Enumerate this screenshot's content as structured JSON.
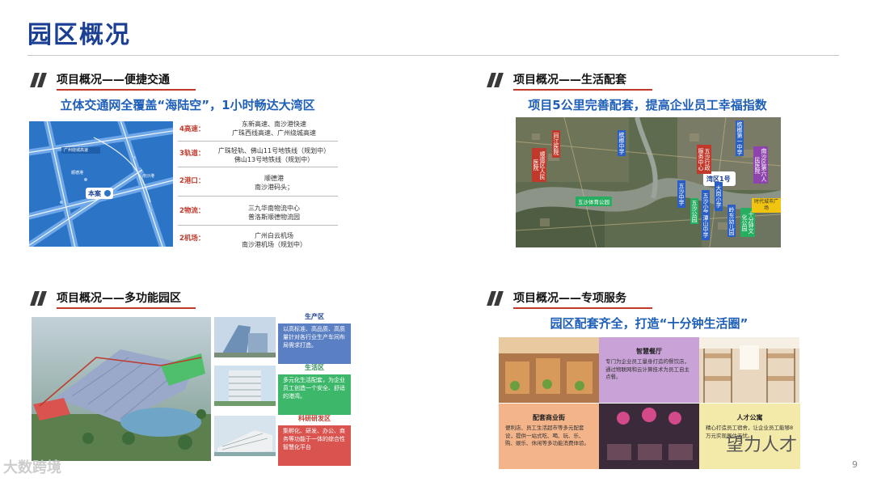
{
  "page": {
    "title": "园区概况",
    "page_number": "9"
  },
  "transport": {
    "section_title": "项目概况——便捷交通",
    "headline": "立体交通网全覆盖“海陆空”，1小时畅达大湾区",
    "map_labels": [
      "本案",
      "广州绕城高速",
      "顺德港",
      "南沙港"
    ],
    "rows": [
      {
        "key": "4高速：",
        "values": [
          "东新高速、南沙港快速",
          "广珠西线高速、广州绕城高速"
        ]
      },
      {
        "key": "3轨道：",
        "values": [
          "广珠轻轨、佛山11号地铁线（规划中）",
          "佛山13号地铁线（规划中）"
        ]
      },
      {
        "key": "2港口：",
        "values": [
          "顺德港",
          "南沙港码头；"
        ]
      },
      {
        "key": "2物流：",
        "values": [
          "三九华南物流中心",
          "普洛斯顺德物流园"
        ]
      },
      {
        "key": "2机场：",
        "values": [
          "广州白云机场",
          "南沙港机场（规划中）"
        ]
      }
    ]
  },
  "living": {
    "section_title": "项目概况——生活配套",
    "headline": "项目5公里完善配套，提高企业员工幸福指数",
    "tags": [
      {
        "text": "顺德区人民医院",
        "color": "#c0392b"
      },
      {
        "text": "同江医院",
        "color": "#c0392b"
      },
      {
        "text": "槟榔中学",
        "color": "#2a5fc4"
      },
      {
        "text": "五沙行政服务中心",
        "color": "#c0392b"
      },
      {
        "text": "槟榔第一中学",
        "color": "#2a5fc4"
      },
      {
        "text": "南沙区第六人民医院",
        "color": "#8e44ad"
      },
      {
        "text": "五沙中学",
        "color": "#2a5fc4"
      },
      {
        "text": "五沙小学",
        "color": "#2a5fc4"
      },
      {
        "text": "大岗小学",
        "color": "#2a5fc4"
      },
      {
        "text": "五沙公园",
        "color": "#27ae60"
      },
      {
        "text": "潭山中学",
        "color": "#2a5fc4"
      },
      {
        "text": "岭东幼儿园",
        "color": "#2a5fc4"
      },
      {
        "text": "十分钟文化公园",
        "color": "#27ae60"
      },
      {
        "text": "时代城市广场",
        "color": "#f1c40f"
      },
      {
        "text": "五沙体育公园",
        "color": "#27ae60"
      }
    ],
    "logo_text": "湾区1号"
  },
  "park": {
    "section_title": "项目概况——多功能园区",
    "zones": [
      {
        "title": "生产区",
        "text": "以高标准、高品质、高质量针对各行业生产车间布局需求打造。",
        "color": "#5b7fc3",
        "title_color": "#1b3f93"
      },
      {
        "title": "生活区",
        "text": "多元化生活配套，为企业员工创造一个安全、舒适的港湾。",
        "color": "#3db86b",
        "title_color": "#2e8b57"
      },
      {
        "title": "科研研发区",
        "text": "集孵化、研发、办公、商务等功能于一体的综合性智慧化平台",
        "color": "#d9534f",
        "title_color": "#c0392b"
      }
    ]
  },
  "services": {
    "section_title": "项目概况——专项服务",
    "headline": "园区配套齐全，打造“十分钟生活圈”",
    "cells": [
      {
        "title": "智慧餐厅",
        "text": "专门为企业员工量身打造的餐饮店，通过物联网和云计算技术为员工自主点餐。",
        "color": "#c9a3d8"
      },
      {
        "title": "配套商业街",
        "text": "便利店、员工生活超市等多元配套设，提供一站式吃、喝、玩、乐、购、娱乐、休闲等多功能消费体验。",
        "color": "#f4b48a"
      },
      {
        "title": "人才公寓",
        "text": "精心打造员工宿舍，让企业员工能够8万元实现居住无忧。",
        "color": "#f3e9a8"
      }
    ]
  },
  "watermarks": {
    "left": "大数跨境",
    "right": "望力人才"
  }
}
